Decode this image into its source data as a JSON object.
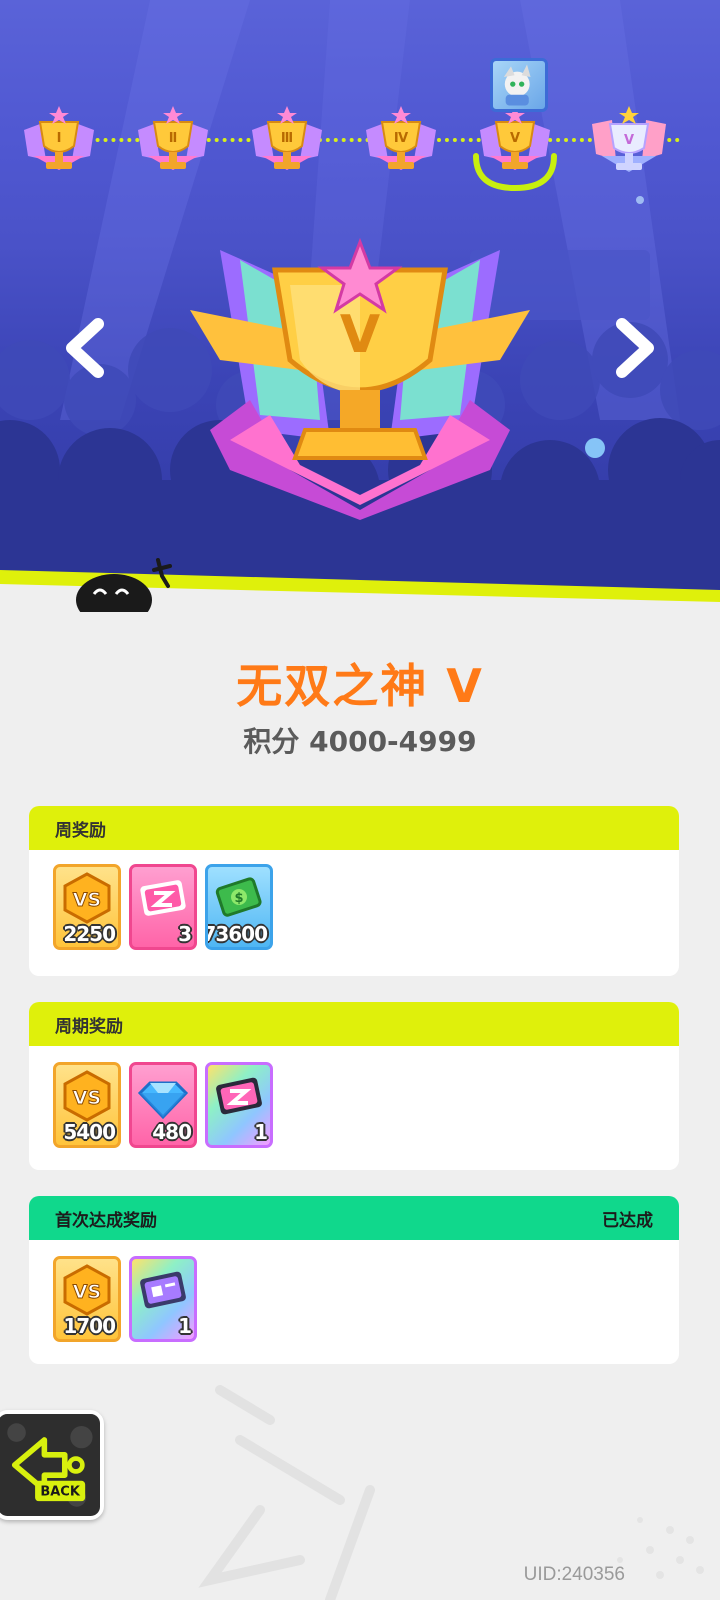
{
  "tiers": [
    {
      "numeral": "Ⅰ",
      "state": "unlocked"
    },
    {
      "numeral": "Ⅱ",
      "state": "unlocked"
    },
    {
      "numeral": "Ⅲ",
      "state": "unlocked"
    },
    {
      "numeral": "Ⅳ",
      "state": "unlocked"
    },
    {
      "numeral": "Ⅴ",
      "state": "current"
    },
    {
      "numeral": "Ⅴ",
      "state": "next"
    }
  ],
  "selected_trophy": {
    "numeral": "V"
  },
  "rank": {
    "title": "无双之神 V",
    "score_range": "积分 4000-4999"
  },
  "weekly_rewards": {
    "header": "周奖励",
    "items": [
      {
        "icon": "vs-coin-icon",
        "count": "2250"
      },
      {
        "icon": "pink-ticket-icon",
        "count": "3"
      },
      {
        "icon": "cash-icon",
        "count": "73600"
      }
    ]
  },
  "period_rewards": {
    "header": "周期奖励",
    "items": [
      {
        "icon": "vs-coin-icon",
        "count": "5400"
      },
      {
        "icon": "diamond-icon",
        "count": "480"
      },
      {
        "icon": "rainbow-ticket-icon",
        "count": "1"
      }
    ]
  },
  "first_reach_rewards": {
    "header": "首次达成奖励",
    "status": "已达成",
    "items": [
      {
        "icon": "vs-coin-icon",
        "count": "1700"
      },
      {
        "icon": "purple-ticket-icon",
        "count": "1"
      }
    ]
  },
  "back_button": {
    "label": "BACK"
  },
  "uid": "UID:240356",
  "colors": {
    "accent_lime": "#dff00b",
    "accent_green": "#10d88c",
    "title_orange": "#ff7a17",
    "scene_blue": "#4a52c8"
  }
}
